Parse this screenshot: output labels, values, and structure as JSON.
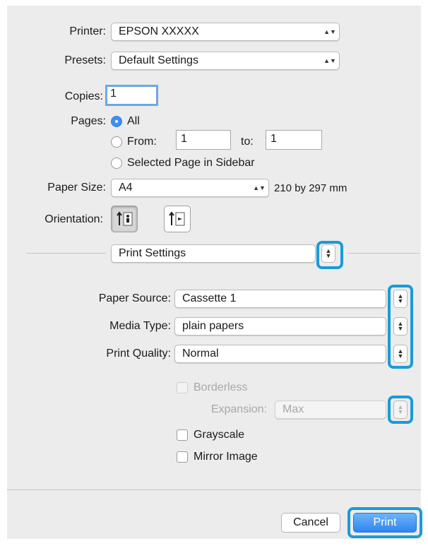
{
  "printer": {
    "label": "Printer:",
    "value": "EPSON XXXXX"
  },
  "presets": {
    "label": "Presets:",
    "value": "Default Settings"
  },
  "copies": {
    "label": "Copies:",
    "value": "1"
  },
  "pages": {
    "label": "Pages:",
    "all_label": "All",
    "from_label": "From:",
    "from_value": "1",
    "to_label": "to:",
    "to_value": "1",
    "selected_label": "Selected Page in Sidebar"
  },
  "paper_size": {
    "label": "Paper Size:",
    "value": "A4",
    "dimensions": "210 by 297 mm"
  },
  "orientation": {
    "label": "Orientation:"
  },
  "section": {
    "value": "Print Settings"
  },
  "paper_source": {
    "label": "Paper Source:",
    "value": "Cassette 1"
  },
  "media_type": {
    "label": "Media Type:",
    "value": "plain papers"
  },
  "print_quality": {
    "label": "Print Quality:",
    "value": "Normal"
  },
  "borderless": {
    "label": "Borderless"
  },
  "expansion": {
    "label": "Expansion:",
    "value": "Max"
  },
  "grayscale": {
    "label": "Grayscale"
  },
  "mirror": {
    "label": "Mirror Image"
  },
  "buttons": {
    "cancel": "Cancel",
    "print": "Print"
  },
  "colors": {
    "highlight": "#1a9bd7",
    "default_button": "#2f86ee",
    "dialog_bg": "#ececec"
  }
}
